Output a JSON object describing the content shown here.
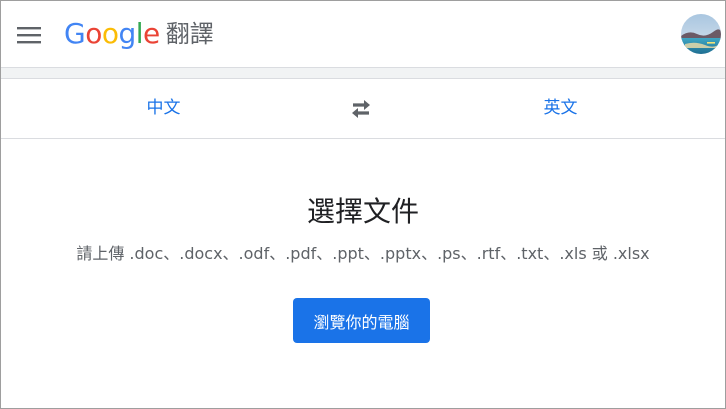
{
  "header": {
    "logo_letters": [
      "G",
      "o",
      "o",
      "g",
      "l",
      "e"
    ],
    "logo_colors": [
      "#4285F4",
      "#EA4335",
      "#FBBC05",
      "#4285F4",
      "#34A853",
      "#EA4335"
    ],
    "product_name": "翻譯",
    "menu_icon": "hamburger-menu-icon",
    "avatar_icon": "user-avatar"
  },
  "language_bar": {
    "source_language": "中文",
    "target_language": "英文",
    "swap_icon": "swap-arrows-icon",
    "accent_color": "#1a73e8"
  },
  "main": {
    "title": "選擇文件",
    "subtitle": "請上傳 .doc、.docx、.odf、.pdf、.ppt、.pptx、.ps、.rtf、.txt、.xls 或 .xlsx",
    "browse_button_label": "瀏覽你的電腦",
    "button_color": "#1a73e8"
  }
}
